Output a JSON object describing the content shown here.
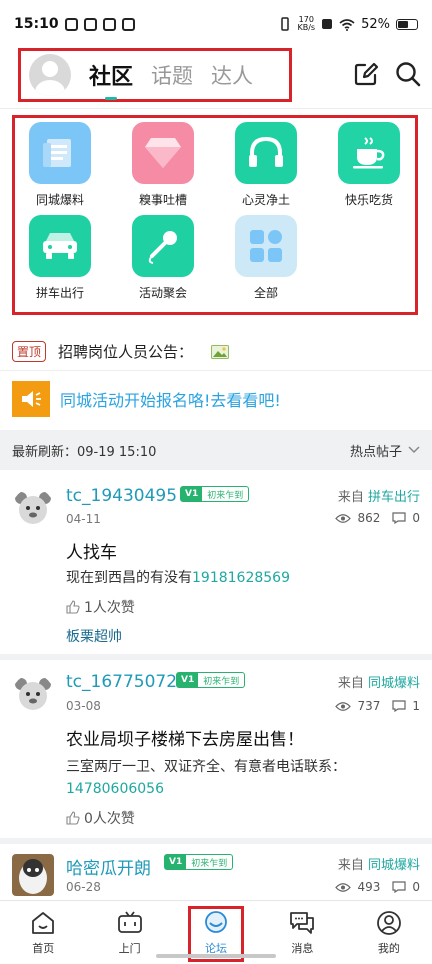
{
  "status_bar": {
    "time": "15:10",
    "net_speed_top": "170",
    "net_speed_bottom": "KB/s",
    "battery": "52%"
  },
  "header": {
    "tabs": [
      {
        "label": "社区",
        "active": true
      },
      {
        "label": "话题",
        "active": false
      },
      {
        "label": "达人",
        "active": false
      }
    ],
    "icons": [
      "edit-icon",
      "search-icon"
    ]
  },
  "categories": [
    {
      "label": "同城爆料",
      "icon": "newspaper-icon",
      "color": "#5bb8f5"
    },
    {
      "label": "糗事吐槽",
      "icon": "diamond-icon",
      "color": "#f47b9a"
    },
    {
      "label": "心灵净土",
      "icon": "headphones-icon",
      "color": "#1fd1a2"
    },
    {
      "label": "快乐吃货",
      "icon": "coffee-cup-icon",
      "color": "#22d3a6"
    },
    {
      "label": "拼车出行",
      "icon": "car-icon",
      "color": "#1fd1a2"
    },
    {
      "label": "活动聚会",
      "icon": "microphone-icon",
      "color": "#1fd1a2"
    },
    {
      "label": "全部",
      "icon": "grid-icon",
      "color": "#cde9f7"
    }
  ],
  "notice": {
    "badge": "置顶",
    "text": "招聘岗位人员公告："
  },
  "promo": {
    "text": "同城活动开始报名咯!去看看吧!"
  },
  "refresh": {
    "text": "最新刷新：09-19 15:10",
    "sort_label": "热点帖子"
  },
  "posts": [
    {
      "username": "tc_19430495",
      "badge_v": "V1",
      "badge_text": "初来乍到",
      "date": "04-11",
      "from_prefix": "来自",
      "category": "拼车出行",
      "views": "862",
      "comments": "0",
      "title": "人找车",
      "body_text": "现在到西昌的有没有",
      "body_phone": "19181628569",
      "likes": "1人次赞",
      "reply": "板栗超帅"
    },
    {
      "username": "tc_16775072",
      "badge_v": "V1",
      "badge_text": "初来乍到",
      "date": "03-08",
      "from_prefix": "来自",
      "category": "同城爆料",
      "views": "737",
      "comments": "1",
      "title": "农业局坝子楼梯下去房屋出售！",
      "body_text": "三室两厅一卫、双证齐全、有意者电话联系：",
      "body_phone": "14780606056",
      "likes": "0人次赞"
    },
    {
      "username": "哈密瓜开朗",
      "badge_v": "V1",
      "badge_text": "初来乍到",
      "date": "06-28",
      "from_prefix": "来自",
      "category": "同城爆料",
      "views": "493",
      "comments": "0"
    }
  ],
  "bottom_nav": [
    {
      "label": "首页",
      "icon": "home-icon"
    },
    {
      "label": "上门",
      "icon": "tv-icon"
    },
    {
      "label": "论坛",
      "icon": "forum-icon",
      "active": true
    },
    {
      "label": "消息",
      "icon": "message-icon"
    },
    {
      "label": "我的",
      "icon": "profile-icon"
    }
  ]
}
